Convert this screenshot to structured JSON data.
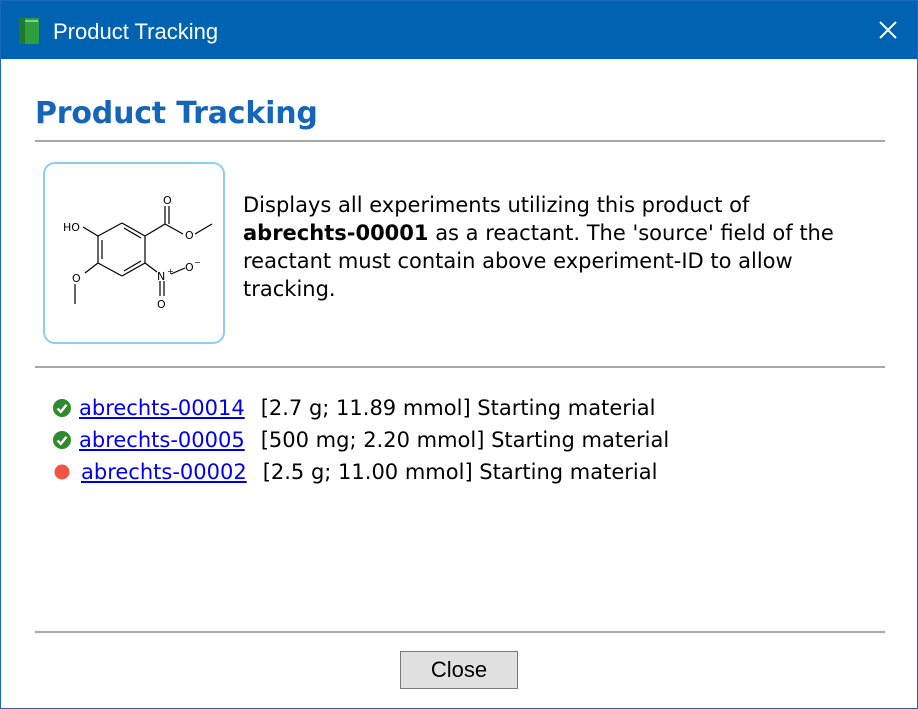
{
  "window": {
    "title": "Product Tracking",
    "title_bar_color": "#0063b1",
    "close_label": "Close window"
  },
  "header": {
    "title": "Product Tracking",
    "color": "#1565b8"
  },
  "molecule": {
    "atom_labels": {
      "ho": "HO",
      "o_top": "O",
      "o_ester": "O",
      "o_methoxy": "O",
      "n": "N",
      "n_charge": "+",
      "o_nitro_right": "O",
      "o_nitro_charge": "−",
      "o_nitro_bottom": "O"
    }
  },
  "description": {
    "line1": "Displays all experiments utilizing this product of",
    "experiment_id": "abrechts-00001",
    "line2_rest": " as a reactant. The 'source' field of the",
    "line3": "reactant must contain above experiment-ID to allow",
    "line4": "tracking."
  },
  "experiments": [
    {
      "id": "abrechts-00014",
      "info": "[2.7 g; 11.89 mmol] Starting material",
      "status": "check",
      "status_color": "#2e8b2e"
    },
    {
      "id": "abrechts-00005",
      "info": "[500 mg; 2.20 mmol] Starting material",
      "status": "check",
      "status_color": "#2e8b2e"
    },
    {
      "id": "abrechts-00002",
      "info": "[2.5 g; 11.00 mmol] Starting material",
      "status": "dot",
      "status_color": "#f05545"
    }
  ],
  "footer": {
    "close_button": "Close"
  }
}
